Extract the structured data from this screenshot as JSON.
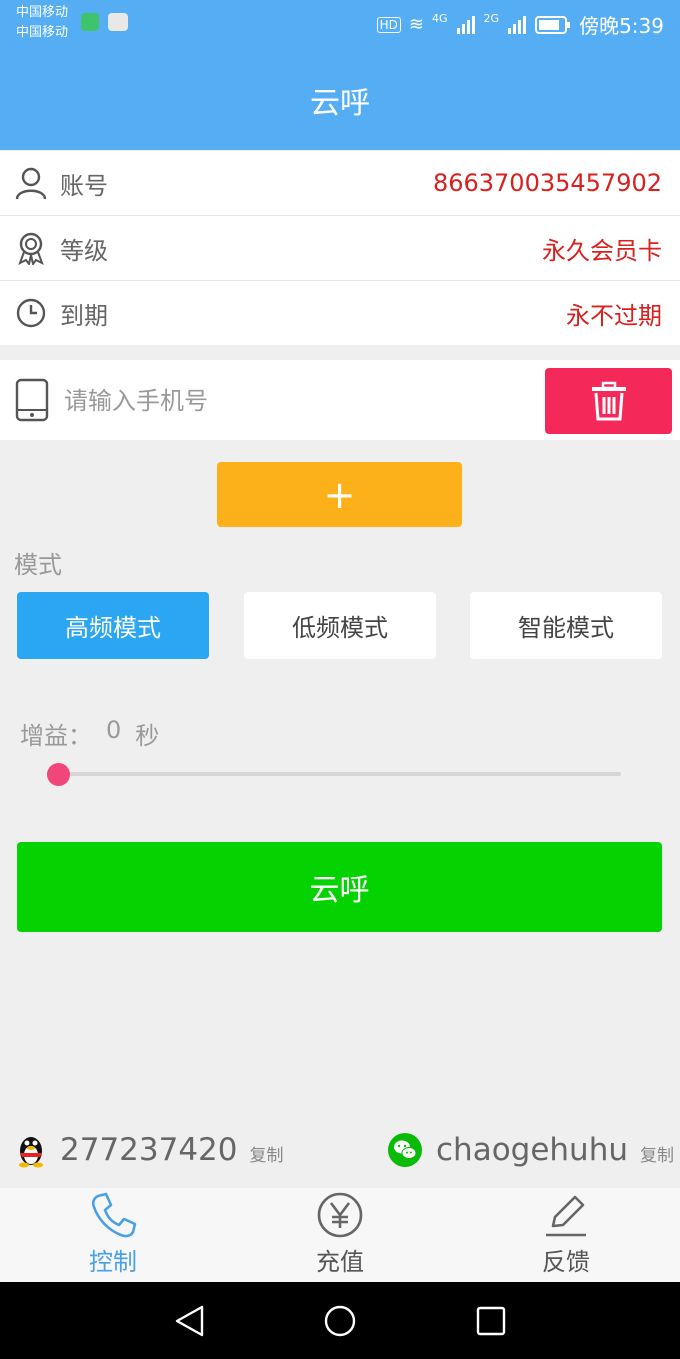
{
  "status_bar": {
    "carrier1": "中国移动",
    "carrier2": "中国移动",
    "hd": "HD",
    "net1": "4G",
    "net2": "2G",
    "time": "傍晚5:39"
  },
  "header": {
    "title": "云呼"
  },
  "info": {
    "account_label": "账号",
    "account_value": "866370035457902",
    "level_label": "等级",
    "level_value": "永久会员卡",
    "expire_label": "到期",
    "expire_value": "永不过期"
  },
  "phone": {
    "placeholder": "请输入手机号",
    "value": ""
  },
  "add_button_label": "+",
  "mode": {
    "label": "模式",
    "options": [
      "高频模式",
      "低频模式",
      "智能模式"
    ],
    "selected": "高频模式"
  },
  "gain": {
    "label": "增益：",
    "value": "0",
    "unit": "秒",
    "slider_fraction": 0
  },
  "call_button_label": "云呼",
  "contacts": {
    "qq": "277237420",
    "qq_copy": "复制",
    "wechat": "chaogehuhu",
    "wechat_copy": "复制"
  },
  "tabs": [
    {
      "label": "控制",
      "icon": "phone-icon",
      "active": true
    },
    {
      "label": "充值",
      "icon": "yen-icon",
      "active": false
    },
    {
      "label": "反馈",
      "icon": "edit-icon",
      "active": false
    }
  ],
  "colors": {
    "header": "#55adf4",
    "value_red": "#d9201e",
    "delete": "#f5285a",
    "add": "#fcb019",
    "mode_active": "#2aa6f2",
    "call": "#05d301",
    "slider_thumb": "#f0467a",
    "tab_active": "#4aa0e6"
  }
}
